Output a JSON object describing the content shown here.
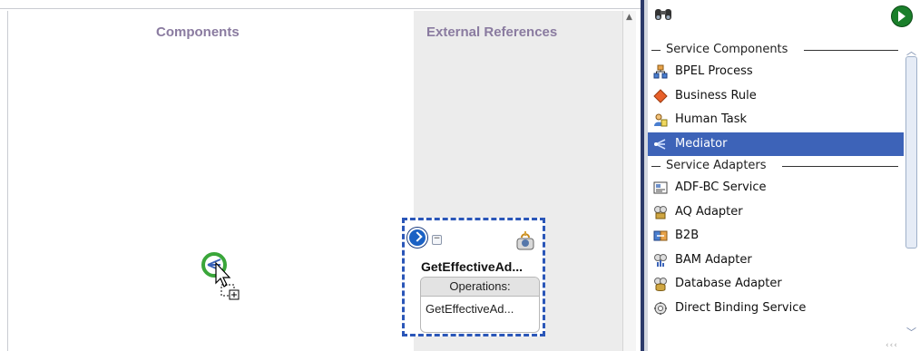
{
  "canvas": {
    "components_title": "Components",
    "external_references_title": "External References",
    "service_card": {
      "name": "GetEffectiveAd...",
      "operations_header": "Operations:",
      "operation": "GetEffectiveAd..."
    }
  },
  "palette": {
    "groups": [
      {
        "label": "Service Components",
        "items": [
          {
            "label": "BPEL Process",
            "icon": "bpel-process-icon"
          },
          {
            "label": "Business Rule",
            "icon": "business-rule-icon"
          },
          {
            "label": "Human Task",
            "icon": "human-task-icon"
          },
          {
            "label": "Mediator",
            "icon": "mediator-icon",
            "selected": true
          }
        ]
      },
      {
        "label": "Service Adapters",
        "items": [
          {
            "label": "ADF-BC Service",
            "icon": "adf-bc-service-icon"
          },
          {
            "label": "AQ Adapter",
            "icon": "aq-adapter-icon"
          },
          {
            "label": "B2B",
            "icon": "b2b-icon"
          },
          {
            "label": "BAM Adapter",
            "icon": "bam-adapter-icon"
          },
          {
            "label": "Database Adapter",
            "icon": "database-adapter-icon"
          },
          {
            "label": "Direct Binding Service",
            "icon": "direct-binding-service-icon"
          }
        ]
      }
    ]
  },
  "colors": {
    "selection": "#3d63b8",
    "lane_title": "#8a7ba0",
    "card_border": "#2a56b8"
  }
}
